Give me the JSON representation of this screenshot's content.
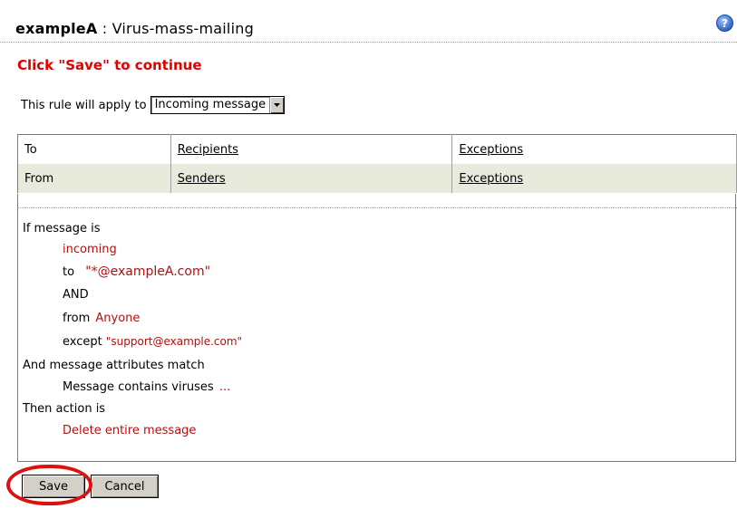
{
  "header": {
    "rule_owner": "exampleA",
    "separator": " : ",
    "rule_name": "Virus-mass-mailing",
    "help_icon": "help-question-icon"
  },
  "instruction": "Click \"Save\" to continue",
  "apply": {
    "label": "This rule will apply to",
    "selected": "Incoming message"
  },
  "criteria_table": {
    "rows": [
      {
        "field": "To",
        "link": "Recipients",
        "exceptions": "Exceptions"
      },
      {
        "field": "From",
        "link": "Senders",
        "exceptions": "Exceptions"
      }
    ]
  },
  "summary": {
    "if_heading": "If message is",
    "direction": "incoming",
    "to_label": "to",
    "to_value": "\"*@exampleA.com\"",
    "and_label": "AND",
    "from_label": "from",
    "from_value": "Anyone",
    "except_label": "except",
    "except_value": "\"support@example.com\"",
    "attributes_heading": "And message attributes match",
    "attribute": "Message contains viruses",
    "attribute_more": "...",
    "action_heading": "Then action is",
    "action": "Delete entire message"
  },
  "buttons": {
    "save": "Save",
    "cancel": "Cancel"
  },
  "colors": {
    "accent_red": "#e00000",
    "value_red": "#b01010",
    "alt_row": "#e8eadb",
    "help_blue": "#3a6fd0"
  }
}
